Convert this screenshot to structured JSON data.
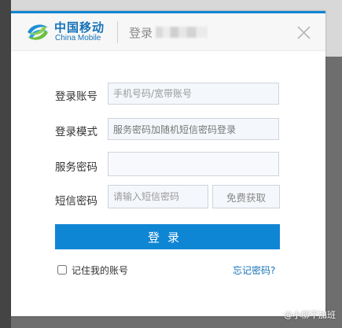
{
  "brand": {
    "name_cn": "中国移动",
    "name_en": "China Mobile"
  },
  "header": {
    "title": "登录",
    "close_icon": "close-icon"
  },
  "form": {
    "account": {
      "label": "登录账号",
      "placeholder": "手机号码/宽带账号",
      "value": ""
    },
    "mode": {
      "label": "登录模式",
      "value": "服务密码加随机短信密码登录"
    },
    "service_password": {
      "label": "服务密码",
      "value": ""
    },
    "sms_password": {
      "label": "短信密码",
      "placeholder": "请输入短信密码",
      "value": ""
    },
    "sms_button_label": "免费获取",
    "login_button_label": "登录",
    "remember_label": "记住我的账号",
    "remember_checked": false,
    "forgot_label": "忘记密码?"
  },
  "watermark": "@小柳不加班",
  "colors": {
    "accent": "#0f86d4",
    "brand": "#1572b9"
  }
}
